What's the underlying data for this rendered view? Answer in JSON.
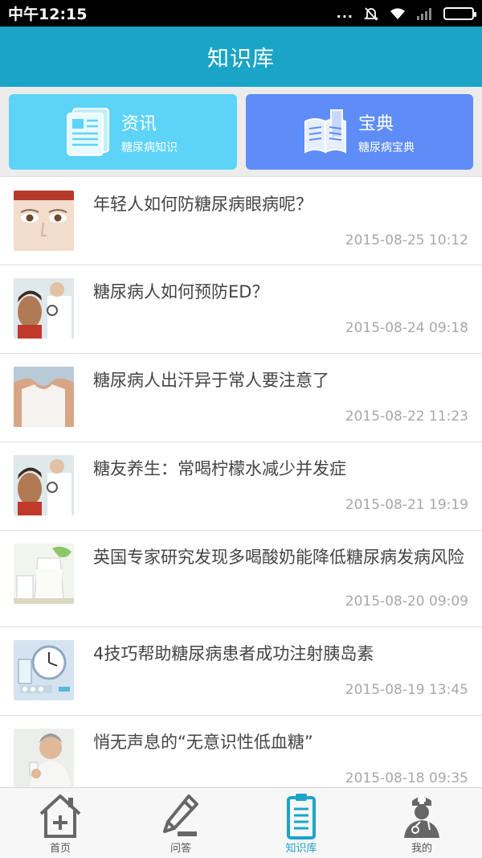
{
  "status_bar": {
    "time": "中午12:15",
    "dots": "...",
    "icons": [
      "mute-icon",
      "wifi-icon",
      "signal-icon",
      "battery-icon"
    ]
  },
  "header": {
    "title": "知识库"
  },
  "categories": [
    {
      "title": "资讯",
      "subtitle": "糖尿病知识",
      "icon": "newspaper-icon",
      "color": "#5dd4f7"
    },
    {
      "title": "宝典",
      "subtitle": "糖尿病宝典",
      "icon": "book-icon",
      "color": "#5e8df8"
    }
  ],
  "news": [
    {
      "title": "年轻人如何防糖尿病眼病呢？",
      "date": "2015-08-25 10:12",
      "thumb": "eyes-photo"
    },
    {
      "title": "糖尿病人如何预防ED？",
      "date": "2015-08-24 09:18",
      "thumb": "doctor-patient-photo"
    },
    {
      "title": "糖尿病人出汗异于常人要注意了",
      "date": "2015-08-22 11:23",
      "thumb": "sweat-shirt-photo"
    },
    {
      "title": "糖友养生：常喝柠檬水减少并发症",
      "date": "2015-08-21 19:19",
      "thumb": "doctor-patient-photo"
    },
    {
      "title": "英国专家研究发现多喝酸奶能降低糖尿病发病风险",
      "date": "2015-08-20 09:09",
      "thumb": "milk-photo"
    },
    {
      "title": "4技巧帮助糖尿病患者成功注射胰岛素",
      "date": "2015-08-19 13:45",
      "thumb": "clock-pills-photo"
    },
    {
      "title": "悄无声息的“无意识性低血糖”",
      "date": "2015-08-18 09:35",
      "thumb": "man-drinking-photo"
    }
  ],
  "tabs": [
    {
      "label": "首页",
      "icon": "home-icon",
      "active": false
    },
    {
      "label": "问答",
      "icon": "pencil-icon",
      "active": false
    },
    {
      "label": "知识库",
      "icon": "clipboard-icon",
      "active": true
    },
    {
      "label": "我的",
      "icon": "doctor-icon",
      "active": false
    }
  ],
  "colors": {
    "header": "#1aa5c7",
    "accent": "#1ba4c8",
    "date": "#a8a8a8"
  }
}
